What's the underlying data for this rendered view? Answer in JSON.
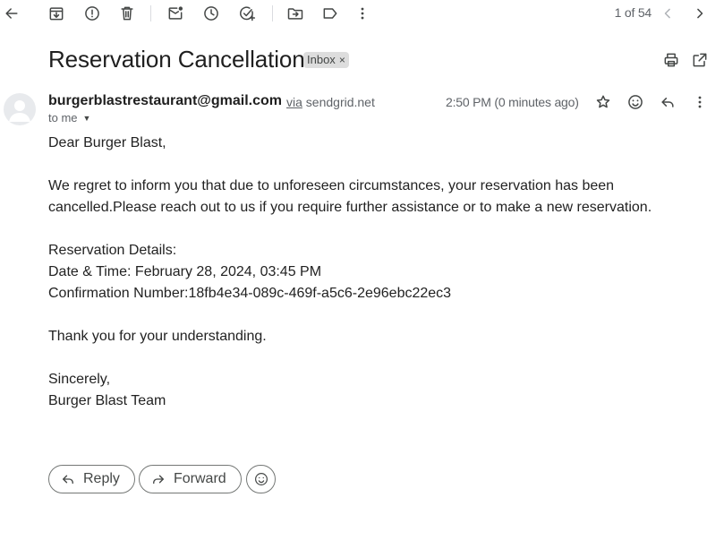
{
  "toolbar": {
    "icons": [
      "back-arrow-icon",
      "archive-icon",
      "report-spam-icon",
      "delete-icon",
      "mark-unread-icon",
      "snooze-icon",
      "add-task-icon",
      "move-to-icon",
      "labels-icon",
      "more-vert-icon"
    ],
    "pager": "1 of 54",
    "nav_icons": [
      "chevron-left-icon",
      "chevron-right-icon"
    ]
  },
  "header": {
    "subject": "Reservation Cancellation",
    "label": "Inbox",
    "label_remove": "×",
    "right_icons": [
      "print-icon",
      "open-in-new-window-icon"
    ]
  },
  "message": {
    "sender_email": "burgerblastrestaurant@gmail.com",
    "via_word": "via",
    "via_domain": "sendgrid.net",
    "recipient": "to me",
    "time": "2:50 PM (0 minutes ago)",
    "action_icons": [
      "star-icon",
      "emoji-reaction-icon",
      "reply-icon",
      "more-vert-icon"
    ],
    "body": {
      "greeting": "Dear Burger Blast,",
      "paragraph1": "We regret to inform you that due to unforeseen circumstances, your reservation has been cancelled.Please reach out to us if you require further assistance or to make a new reservation.",
      "details_heading": "Reservation Details:",
      "date_time": "Date & Time: February 28, 2024, 03:45 PM",
      "confirmation": "Confirmation Number:18fb4e34-089c-469f-a5c6-2e96ebc22ec3",
      "thanks": "Thank you for your understanding.",
      "closing": "Sincerely,",
      "signature": "Burger Blast Team"
    }
  },
  "actions": {
    "reply_label": "Reply",
    "forward_label": "Forward"
  }
}
